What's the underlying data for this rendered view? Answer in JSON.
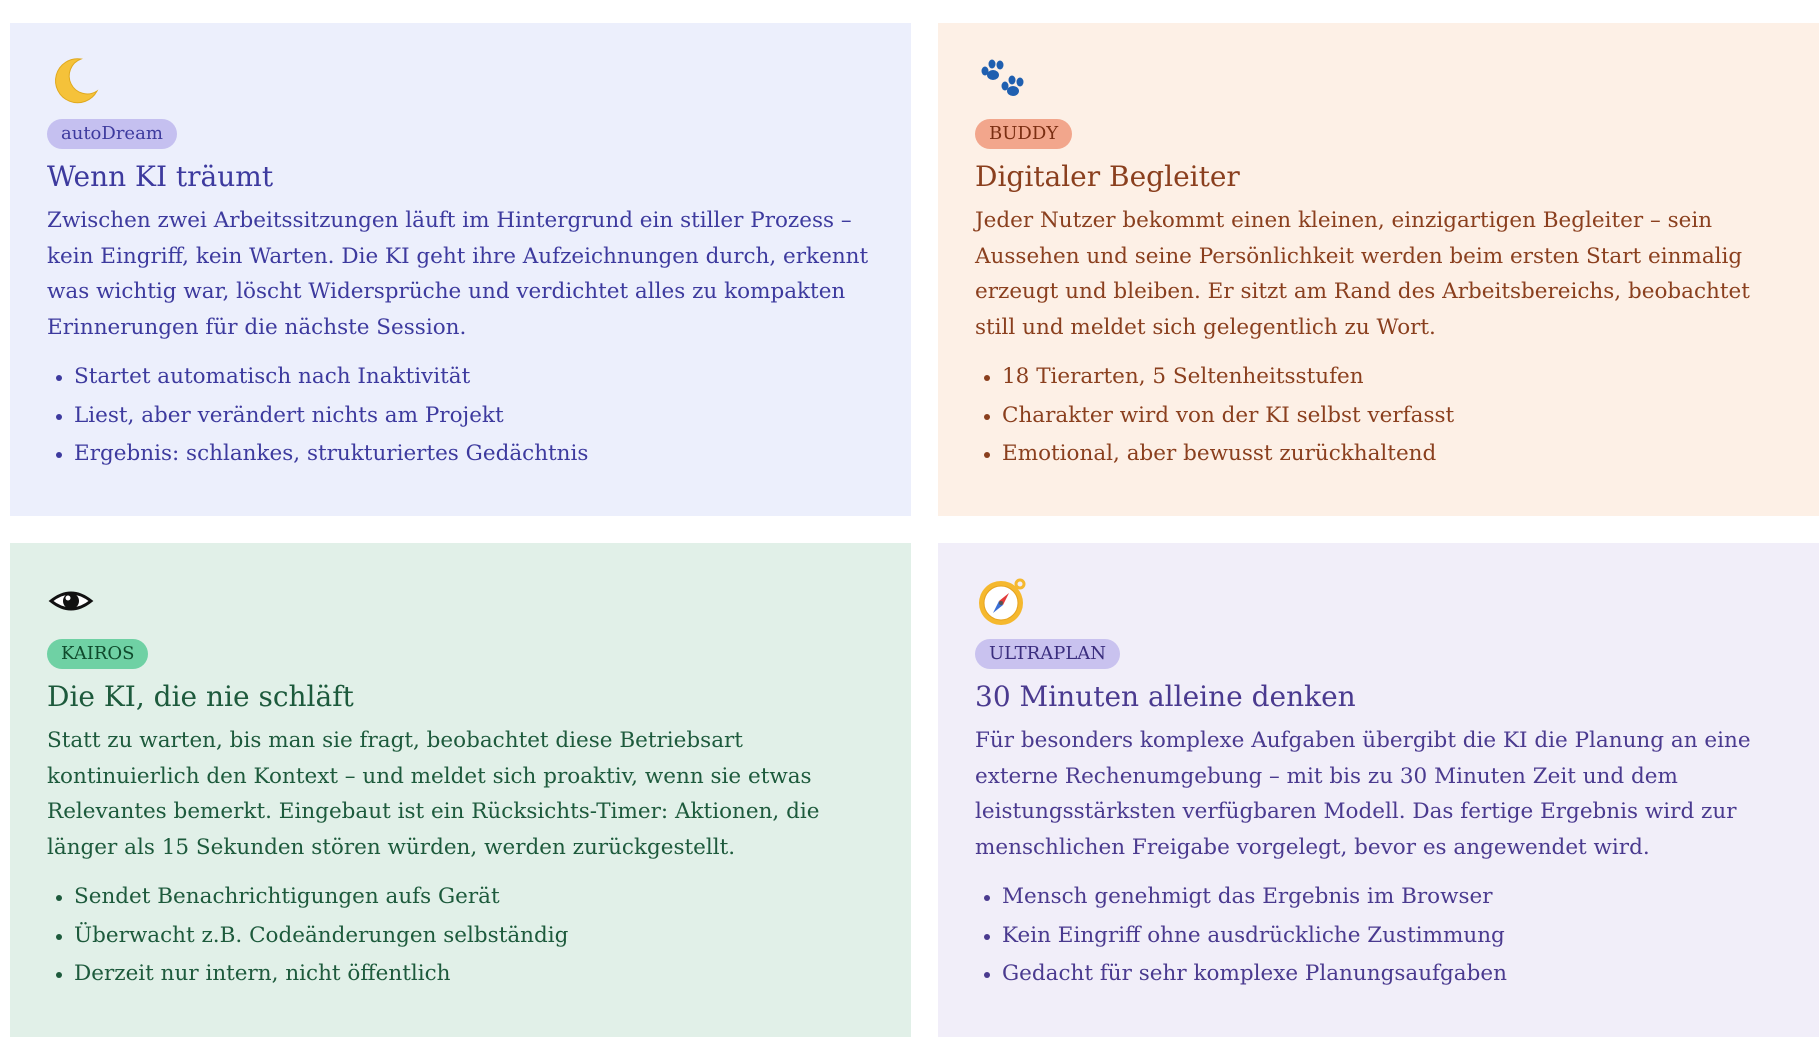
{
  "cards": [
    {
      "icon": "crescent-moon-icon",
      "badge": "autoDream",
      "title": "Wenn KI träumt",
      "description": "Zwischen zwei Arbeitssitzungen läuft im Hintergrund ein stiller Prozess – kein Eingriff, kein Warten. Die KI geht ihre Aufzeichnungen durch, erkennt was wichtig war, löscht Widersprüche und verdichtet alles zu kompakten Erinnerungen für die nächste Session.",
      "points": [
        "Startet automatisch nach Inaktivität",
        "Liest, aber verändert nichts am Projekt",
        "Ergebnis: schlankes, strukturiertes Gedächtnis"
      ],
      "colors": {
        "background": "#eceffc",
        "text": "#3d3a9e",
        "badge_bg": "#c5c0f0",
        "badge_text": "#3d3a9e"
      }
    },
    {
      "icon": "paw-prints-icon",
      "badge": "BUDDY",
      "title": "Digitaler Begleiter",
      "description": "Jeder Nutzer bekommt einen kleinen, einzigartigen Begleiter – sein Aussehen und seine Persönlichkeit werden beim ersten Start einmalig erzeugt und bleiben. Er sitzt am Rand des Arbeitsbereichs, beobachtet still und meldet sich gelegentlich zu Wort.",
      "points": [
        "18 Tierarten, 5 Seltenheitsstufen",
        "Charakter wird von der KI selbst verfasst",
        "Emotional, aber bewusst zurückhaltend"
      ],
      "colors": {
        "background": "#fdf0e6",
        "text": "#8a3f1e",
        "badge_bg": "#f2a68c",
        "badge_text": "#7a2e12"
      }
    },
    {
      "icon": "eye-icon",
      "badge": "KAIROS",
      "title": "Die KI, die nie schläft",
      "description": "Statt zu warten, bis man sie fragt, beobachtet diese Betriebsart kontinuierlich den Kontext – und meldet sich proaktiv, wenn sie etwas Relevantes bemerkt. Eingebaut ist ein Rücksichts-Timer: Aktionen, die länger als 15 Sekunden stören würden, werden zurückgestellt.",
      "points": [
        "Sendet Benachrichtigungen aufs Gerät",
        "Überwacht z.B. Codeänderungen selbständig",
        "Derzeit nur intern, nicht öffentlich"
      ],
      "colors": {
        "background": "#e1f0e8",
        "text": "#1d5a3c",
        "badge_bg": "#6fd1a4",
        "badge_text": "#0f4a2c"
      }
    },
    {
      "icon": "compass-icon",
      "badge": "ULTRAPLAN",
      "title": "30 Minuten alleine denken",
      "description": "Für besonders komplexe Aufgaben übergibt die KI die Planung an eine externe Rechenumgebung – mit bis zu 30 Minuten Zeit und dem leistungsstärksten verfügbaren Modell. Das fertige Ergebnis wird zur menschlichen Freigabe vorgelegt, bevor es angewendet wird.",
      "points": [
        "Mensch genehmigt das Ergebnis im Browser",
        "Kein Eingriff ohne ausdrückliche Zustimmung",
        "Gedacht für sehr komplexe Planungsaufgaben"
      ],
      "colors": {
        "background": "#f1eef9",
        "text": "#4a3a8f",
        "badge_bg": "#c9c2ef",
        "badge_text": "#3a2d7e"
      }
    }
  ]
}
